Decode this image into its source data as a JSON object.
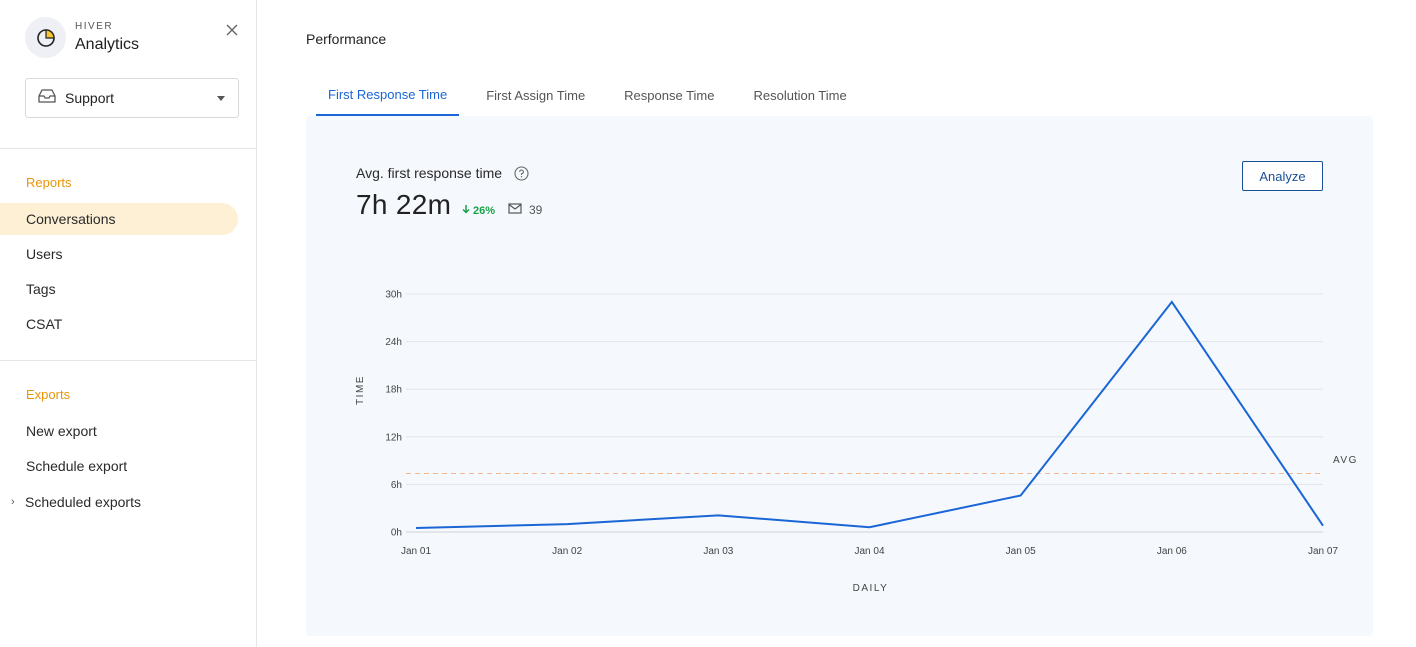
{
  "sidebar": {
    "brand_small": "HIVER",
    "brand_big": "Analytics",
    "mailbox": "Support",
    "reports_title": "Reports",
    "reports": [
      "Conversations",
      "Users",
      "Tags",
      "CSAT"
    ],
    "exports_title": "Exports",
    "exports": [
      "New export",
      "Schedule export",
      "Scheduled exports"
    ]
  },
  "main": {
    "page_title": "Performance",
    "tabs": [
      "First Response Time",
      "First Assign Time",
      "Response Time",
      "Resolution Time"
    ],
    "metric": {
      "title": "Avg. first response time",
      "value": "7h 22m",
      "change": "26%",
      "count": "39"
    },
    "analyze_label": "Analyze"
  },
  "colors": {
    "accent": "#1a66d6",
    "section_title": "#e8950c",
    "positive": "#18a24a",
    "avg_line": "#f3b68f",
    "active_nav_bg": "#fdf0d5"
  },
  "chart_data": {
    "type": "line",
    "x": [
      "Jan 01",
      "Jan 02",
      "Jan 03",
      "Jan 04",
      "Jan 05",
      "Jan 06",
      "Jan 07"
    ],
    "series": [
      {
        "values": [
          0.5,
          1.0,
          2.1,
          0.6,
          4.6,
          29.0,
          0.8
        ]
      }
    ],
    "avg": 7.37,
    "avg_label": "AVG",
    "ylabel": "TIME",
    "xlabel": "DAILY",
    "ylim": [
      0,
      30
    ],
    "yticks": [
      "0h",
      "6h",
      "12h",
      "18h",
      "24h",
      "30h"
    ],
    "grid": true
  }
}
